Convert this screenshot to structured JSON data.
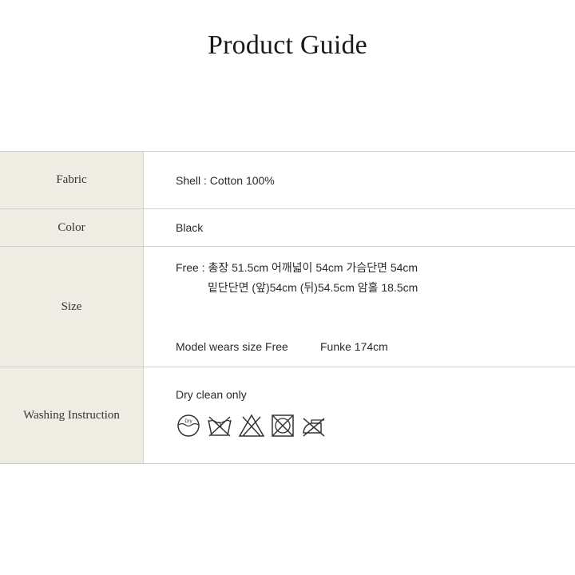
{
  "page": {
    "title": "Product Guide"
  },
  "rows": {
    "fabric": {
      "label": "Fabric",
      "value": "Shell : Cotton 100%"
    },
    "color": {
      "label": "Color",
      "value": "Black"
    },
    "size": {
      "label": "Size",
      "line1": "Free : 총장 51.5cm 어깨넓이 54cm 가슴단면 54cm",
      "line2": "밑단단면 (앞)54cm (뒤)54.5cm 암홀 18.5cm",
      "model": "Model wears size Free",
      "model_height": "Funke 174cm"
    },
    "washing": {
      "label": "Washing Instruction",
      "text": "Dry clean only",
      "dry_icon_text": "Dry",
      "icons": [
        "dry-clean-icon",
        "no-hand-wash-icon",
        "no-bleach-icon",
        "no-tumble-dry-icon",
        "no-iron-icon"
      ]
    }
  }
}
